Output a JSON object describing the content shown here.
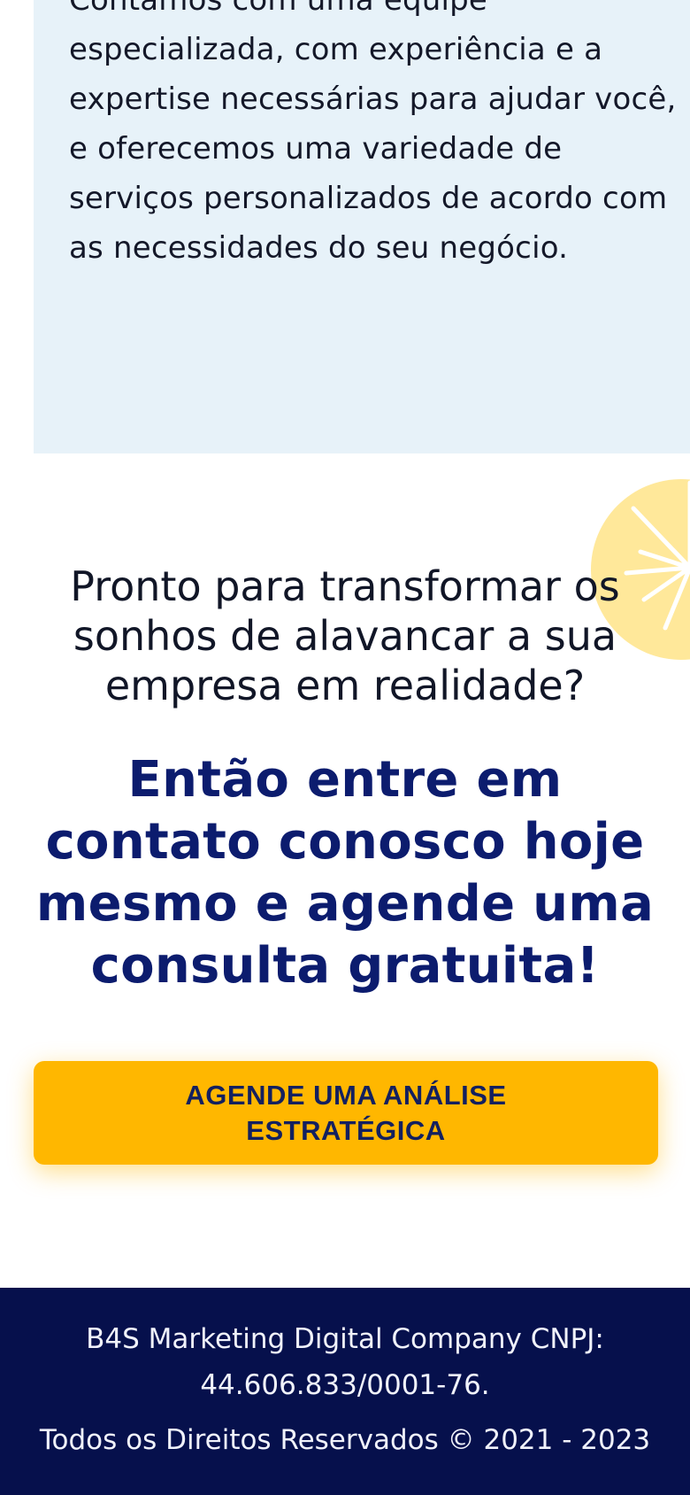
{
  "intro": {
    "text": "Contamos com uma equipe especializada, com experiência e a expertise necessárias para ajudar você, e oferecemos uma variedade de serviços personalizados de acordo com as necessidades do seu negócio."
  },
  "cta_section": {
    "question": "Pronto para transformar os sonhos de alavancar a sua empresa em realidade?",
    "heading": "Então entre em contato conosco hoje mesmo e agende uma consulta gratuita!",
    "button_label": "AGENDE UMA ANÁLISE ESTRATÉGICA"
  },
  "footer": {
    "company_line": "B4S Marketing Digital Company CNPJ: 44.606.833/0001-76.",
    "rights_line": "Todos os Direitos Reservados © 2021 - 2023"
  },
  "colors": {
    "intro_background": "#e7f2f9",
    "heading": "#0c1c6e",
    "button": "#ffb700",
    "footer_background": "#06104c",
    "decoration": "#ffe89a"
  },
  "icons": {
    "decoration": "sunburst-icon"
  }
}
